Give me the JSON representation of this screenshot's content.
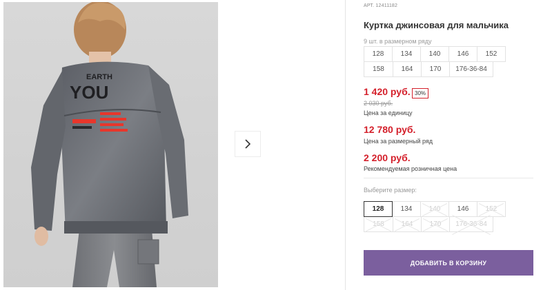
{
  "product": {
    "article": "АРТ. 12411182",
    "title": "Куртка джинсовая для мальчика",
    "row_count": "9 шт. в размерном ряду",
    "sizes_in_row": [
      "128",
      "134",
      "140",
      "146",
      "152",
      "158",
      "164",
      "170",
      "176-36-84"
    ]
  },
  "pricing": {
    "unit_price": "1 420 руб.",
    "discount": "30%",
    "old_price": "2 030 руб.",
    "unit_price_label": "Цена за единицу",
    "row_price": "12 780 руб.",
    "row_price_label": "Цена за размерный ряд",
    "retail_price": "2 200 руб.",
    "retail_price_label": "Рекомендуемая розничная цена"
  },
  "size_select": {
    "label": "Выберите размер:",
    "selected": "128",
    "options": [
      {
        "label": "128",
        "available": true
      },
      {
        "label": "134",
        "available": true
      },
      {
        "label": "140",
        "available": false
      },
      {
        "label": "146",
        "available": true
      },
      {
        "label": "152",
        "available": false
      },
      {
        "label": "158",
        "available": false
      },
      {
        "label": "164",
        "available": false
      },
      {
        "label": "170",
        "available": false
      },
      {
        "label": "176-36-84",
        "available": false
      }
    ]
  },
  "actions": {
    "add_to_cart": "ДОБАВИТЬ В КОРЗИНУ"
  },
  "gallery": {
    "next_icon": "chevron-right-icon",
    "jacket_print": {
      "line1": "EARTH",
      "line2": "YOU"
    }
  },
  "colors": {
    "price_red": "#d4202b",
    "cart_button": "#7b5f9e",
    "print_red": "#e8362b"
  }
}
